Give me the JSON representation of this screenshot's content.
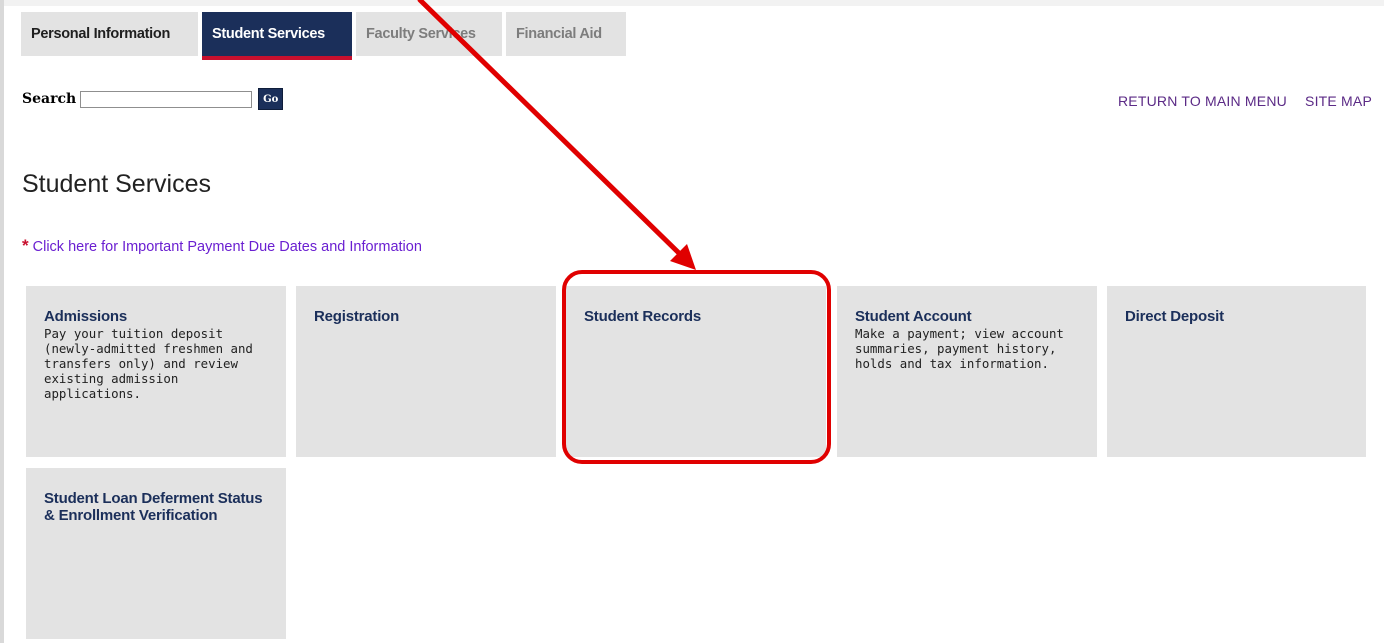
{
  "tabs": [
    {
      "label": "Personal Information"
    },
    {
      "label": "Student Services"
    },
    {
      "label": "Faculty Services"
    },
    {
      "label": "Financial Aid"
    }
  ],
  "search": {
    "label": "Search",
    "value": "",
    "button_label": "Go"
  },
  "toplinks": {
    "main_menu": "RETURN TO MAIN MENU",
    "site_map": "SITE MAP"
  },
  "page_title": "Student Services",
  "notice": {
    "star": "*",
    "link_text": "Click here for Important Payment Due Dates and Information"
  },
  "cards": [
    {
      "title": "Admissions",
      "description": "Pay your tuition deposit (newly-admitted freshmen and transfers only) and review existing admission applications."
    },
    {
      "title": "Registration",
      "description": ""
    },
    {
      "title": "Student Records",
      "description": ""
    },
    {
      "title": "Student Account",
      "description": "Make a payment; view account summaries, payment history, holds and tax information."
    },
    {
      "title": "Direct Deposit",
      "description": ""
    },
    {
      "title": "Student Loan Deferment Status & Enrollment Verification",
      "description": ""
    }
  ],
  "colors": {
    "brand_navy": "#1b2f5a",
    "accent_red": "#c8102e",
    "annotation_red": "#e00000",
    "link_purple": "#5b2a86"
  }
}
